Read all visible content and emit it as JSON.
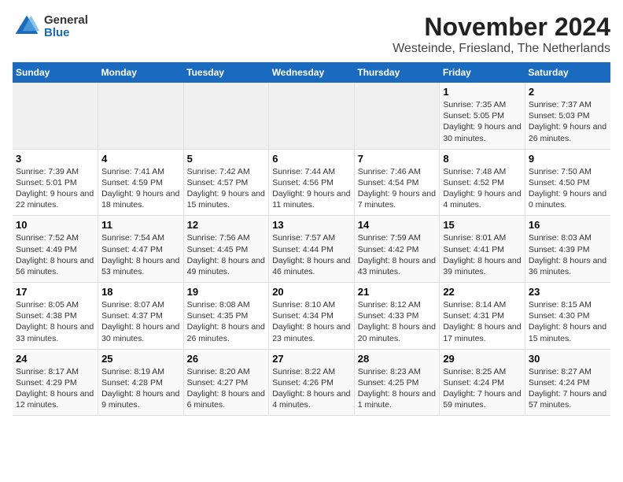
{
  "logo": {
    "general": "General",
    "blue": "Blue"
  },
  "title": "November 2024",
  "subtitle": "Westeinde, Friesland, The Netherlands",
  "headers": [
    "Sunday",
    "Monday",
    "Tuesday",
    "Wednesday",
    "Thursday",
    "Friday",
    "Saturday"
  ],
  "weeks": [
    [
      {
        "day": "",
        "text": ""
      },
      {
        "day": "",
        "text": ""
      },
      {
        "day": "",
        "text": ""
      },
      {
        "day": "",
        "text": ""
      },
      {
        "day": "",
        "text": ""
      },
      {
        "day": "1",
        "text": "Sunrise: 7:35 AM\nSunset: 5:05 PM\nDaylight: 9 hours and 30 minutes."
      },
      {
        "day": "2",
        "text": "Sunrise: 7:37 AM\nSunset: 5:03 PM\nDaylight: 9 hours and 26 minutes."
      }
    ],
    [
      {
        "day": "3",
        "text": "Sunrise: 7:39 AM\nSunset: 5:01 PM\nDaylight: 9 hours and 22 minutes."
      },
      {
        "day": "4",
        "text": "Sunrise: 7:41 AM\nSunset: 4:59 PM\nDaylight: 9 hours and 18 minutes."
      },
      {
        "day": "5",
        "text": "Sunrise: 7:42 AM\nSunset: 4:57 PM\nDaylight: 9 hours and 15 minutes."
      },
      {
        "day": "6",
        "text": "Sunrise: 7:44 AM\nSunset: 4:56 PM\nDaylight: 9 hours and 11 minutes."
      },
      {
        "day": "7",
        "text": "Sunrise: 7:46 AM\nSunset: 4:54 PM\nDaylight: 9 hours and 7 minutes."
      },
      {
        "day": "8",
        "text": "Sunrise: 7:48 AM\nSunset: 4:52 PM\nDaylight: 9 hours and 4 minutes."
      },
      {
        "day": "9",
        "text": "Sunrise: 7:50 AM\nSunset: 4:50 PM\nDaylight: 9 hours and 0 minutes."
      }
    ],
    [
      {
        "day": "10",
        "text": "Sunrise: 7:52 AM\nSunset: 4:49 PM\nDaylight: 8 hours and 56 minutes."
      },
      {
        "day": "11",
        "text": "Sunrise: 7:54 AM\nSunset: 4:47 PM\nDaylight: 8 hours and 53 minutes."
      },
      {
        "day": "12",
        "text": "Sunrise: 7:56 AM\nSunset: 4:45 PM\nDaylight: 8 hours and 49 minutes."
      },
      {
        "day": "13",
        "text": "Sunrise: 7:57 AM\nSunset: 4:44 PM\nDaylight: 8 hours and 46 minutes."
      },
      {
        "day": "14",
        "text": "Sunrise: 7:59 AM\nSunset: 4:42 PM\nDaylight: 8 hours and 43 minutes."
      },
      {
        "day": "15",
        "text": "Sunrise: 8:01 AM\nSunset: 4:41 PM\nDaylight: 8 hours and 39 minutes."
      },
      {
        "day": "16",
        "text": "Sunrise: 8:03 AM\nSunset: 4:39 PM\nDaylight: 8 hours and 36 minutes."
      }
    ],
    [
      {
        "day": "17",
        "text": "Sunrise: 8:05 AM\nSunset: 4:38 PM\nDaylight: 8 hours and 33 minutes."
      },
      {
        "day": "18",
        "text": "Sunrise: 8:07 AM\nSunset: 4:37 PM\nDaylight: 8 hours and 30 minutes."
      },
      {
        "day": "19",
        "text": "Sunrise: 8:08 AM\nSunset: 4:35 PM\nDaylight: 8 hours and 26 minutes."
      },
      {
        "day": "20",
        "text": "Sunrise: 8:10 AM\nSunset: 4:34 PM\nDaylight: 8 hours and 23 minutes."
      },
      {
        "day": "21",
        "text": "Sunrise: 8:12 AM\nSunset: 4:33 PM\nDaylight: 8 hours and 20 minutes."
      },
      {
        "day": "22",
        "text": "Sunrise: 8:14 AM\nSunset: 4:31 PM\nDaylight: 8 hours and 17 minutes."
      },
      {
        "day": "23",
        "text": "Sunrise: 8:15 AM\nSunset: 4:30 PM\nDaylight: 8 hours and 15 minutes."
      }
    ],
    [
      {
        "day": "24",
        "text": "Sunrise: 8:17 AM\nSunset: 4:29 PM\nDaylight: 8 hours and 12 minutes."
      },
      {
        "day": "25",
        "text": "Sunrise: 8:19 AM\nSunset: 4:28 PM\nDaylight: 8 hours and 9 minutes."
      },
      {
        "day": "26",
        "text": "Sunrise: 8:20 AM\nSunset: 4:27 PM\nDaylight: 8 hours and 6 minutes."
      },
      {
        "day": "27",
        "text": "Sunrise: 8:22 AM\nSunset: 4:26 PM\nDaylight: 8 hours and 4 minutes."
      },
      {
        "day": "28",
        "text": "Sunrise: 8:23 AM\nSunset: 4:25 PM\nDaylight: 8 hours and 1 minute."
      },
      {
        "day": "29",
        "text": "Sunrise: 8:25 AM\nSunset: 4:24 PM\nDaylight: 7 hours and 59 minutes."
      },
      {
        "day": "30",
        "text": "Sunrise: 8:27 AM\nSunset: 4:24 PM\nDaylight: 7 hours and 57 minutes."
      }
    ]
  ]
}
